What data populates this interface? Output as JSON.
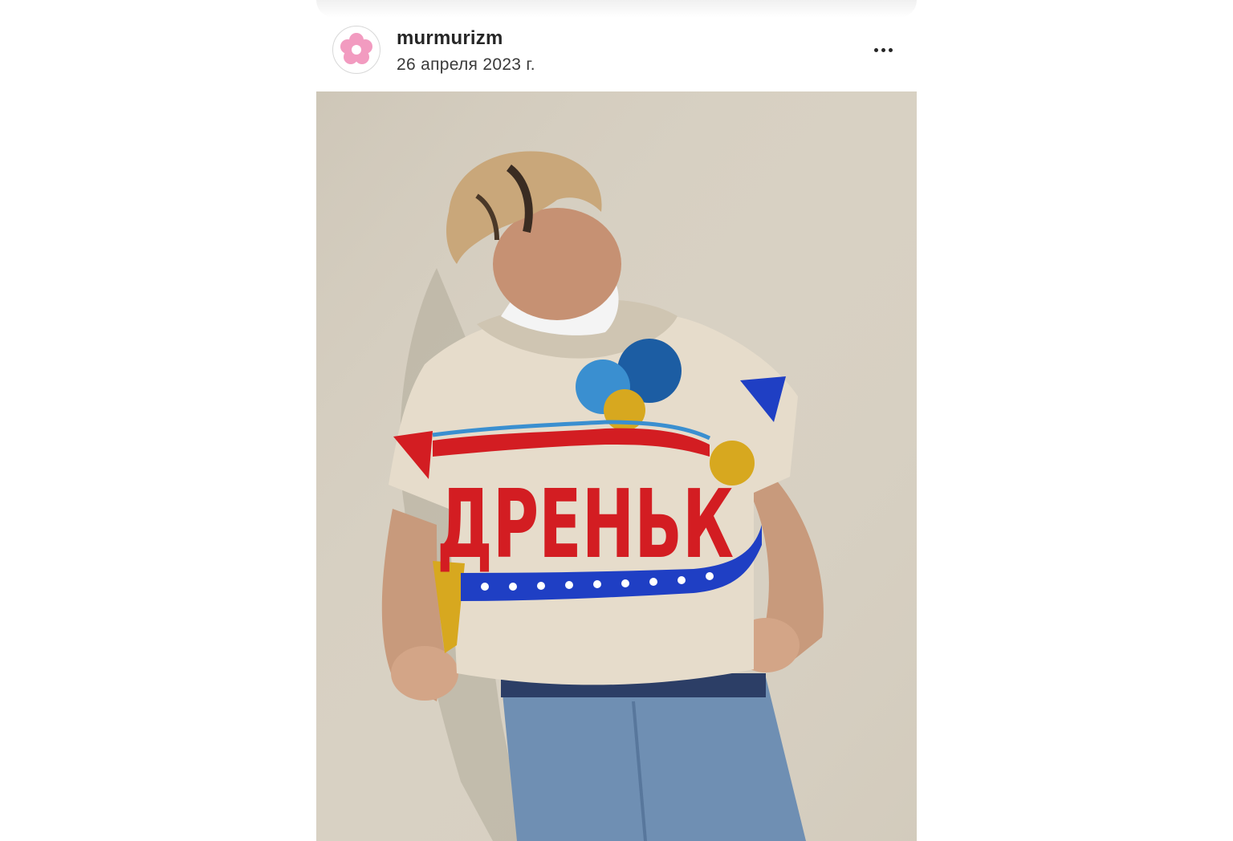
{
  "post": {
    "username": "murmurizm",
    "date": "26 апреля 2023 г.",
    "more_icon": "more-horizontal-icon",
    "avatar_icon": "pink-flower-icon"
  },
  "photo": {
    "sweater_text": "ДРЕНЬК",
    "colors": {
      "wall": "#d6cfc1",
      "sweater": "#e6dccb",
      "red": "#d31d22",
      "blue": "#1f3fc4",
      "yellow": "#d7a81f",
      "light_blue": "#3a8fd0",
      "dark_blue": "#1c5da3",
      "jeans": "#6f8fb3"
    }
  }
}
